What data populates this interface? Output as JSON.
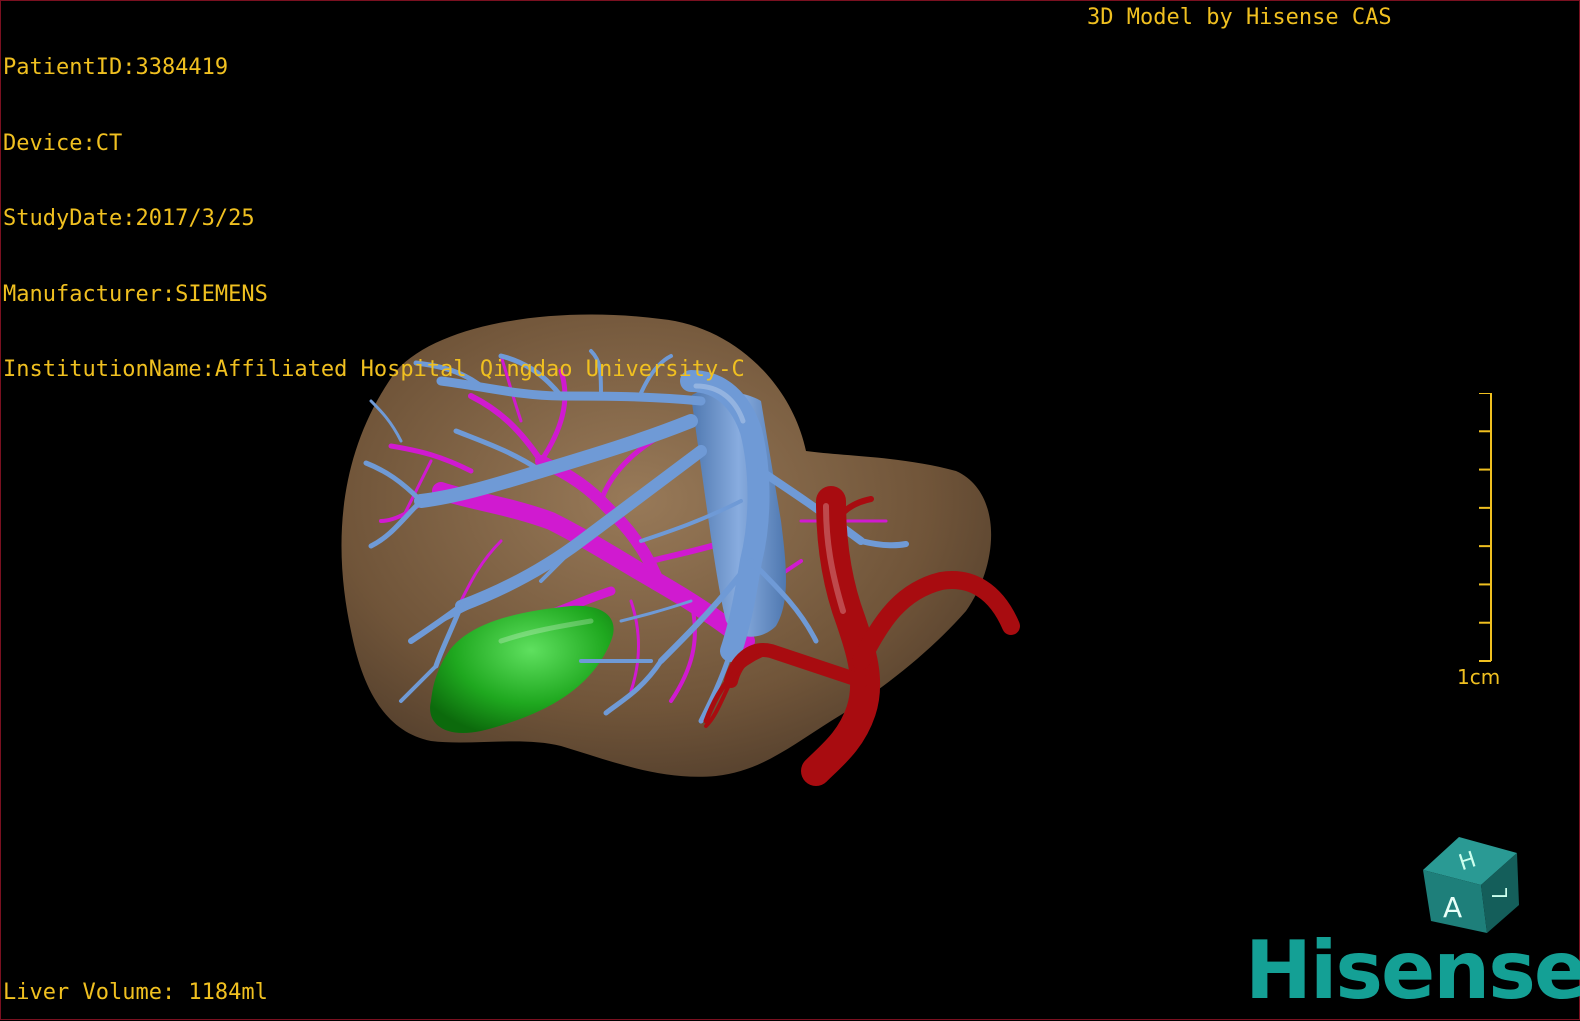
{
  "meta": {
    "patient_id": "PatientID:3384419",
    "device": "Device:CT",
    "study_date": "StudyDate:2017/3/25",
    "manufacturer": "Manufacturer:SIEMENS",
    "institution": "InstitutionName:Affiliated Hospital Qingdao University-C"
  },
  "model_title": "3D Model by Hisense CAS",
  "liver_volume": "Liver Volume: 1184ml",
  "scale": {
    "label": "1cm",
    "ticks": 8
  },
  "orientation_cube": {
    "faces": [
      "H",
      "A",
      "L"
    ],
    "color": "#1e7f7a"
  },
  "brand": {
    "name": "Hisense",
    "color": "#14a095"
  },
  "colors": {
    "text": "#f0c020",
    "liver": "#8a6a48",
    "hepatic_vein": "#6f9ad6",
    "portal_vein": "#d01ad0",
    "artery": "#a80c10",
    "gallbladder": "#1fa81f"
  }
}
